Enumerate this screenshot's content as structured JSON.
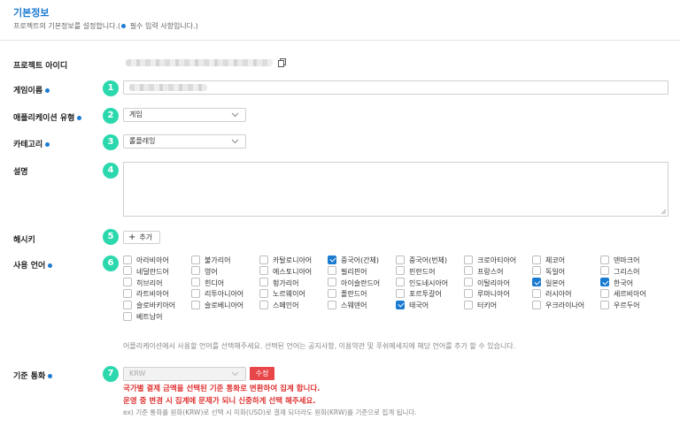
{
  "section": {
    "title": "기본정보",
    "description_prefix": "프로젝트의 기본정보를 설정합니다.(",
    "description_suffix": " 필수 입력 사항입니다.)"
  },
  "fields": {
    "project_id": {
      "label": "프로젝트 아이디"
    },
    "game_name": {
      "label": "게임이름",
      "badge": "1",
      "value": ""
    },
    "app_type": {
      "label": "애플리케이션 유형",
      "badge": "2",
      "value": "게임"
    },
    "category": {
      "label": "카테고리",
      "badge": "3",
      "value": "롤플레잉"
    },
    "description": {
      "label": "설명",
      "badge": "4",
      "value": ""
    },
    "hashtag": {
      "label": "해시키",
      "badge": "5",
      "add_label": "추가",
      "add_icon": "+"
    },
    "languages": {
      "label": "사용 언어",
      "badge": "6",
      "items": [
        {
          "name": "아라비아어",
          "checked": false
        },
        {
          "name": "불가리어",
          "checked": false
        },
        {
          "name": "카탈로니아어",
          "checked": false
        },
        {
          "name": "중국어(간체)",
          "checked": true
        },
        {
          "name": "중국어(번체)",
          "checked": false
        },
        {
          "name": "크로아티아어",
          "checked": false
        },
        {
          "name": "체코어",
          "checked": false
        },
        {
          "name": "덴마크어",
          "checked": false
        },
        {
          "name": "네덜란드어",
          "checked": false
        },
        {
          "name": "영어",
          "checked": false
        },
        {
          "name": "에스토니아어",
          "checked": false
        },
        {
          "name": "필리핀어",
          "checked": false
        },
        {
          "name": "핀란드어",
          "checked": false
        },
        {
          "name": "프랑스어",
          "checked": false
        },
        {
          "name": "독일어",
          "checked": false
        },
        {
          "name": "그리스어",
          "checked": false
        },
        {
          "name": "히브리어",
          "checked": false
        },
        {
          "name": "힌디어",
          "checked": false
        },
        {
          "name": "헝가리어",
          "checked": false
        },
        {
          "name": "아이슬란드어",
          "checked": false
        },
        {
          "name": "인도네시아어",
          "checked": false
        },
        {
          "name": "이탈리아어",
          "checked": false
        },
        {
          "name": "일본어",
          "checked": true
        },
        {
          "name": "한국어",
          "checked": true
        },
        {
          "name": "라트비아어",
          "checked": false
        },
        {
          "name": "리투아니아어",
          "checked": false
        },
        {
          "name": "노르웨이어",
          "checked": false
        },
        {
          "name": "폴란드어",
          "checked": false
        },
        {
          "name": "포르투갈어",
          "checked": false
        },
        {
          "name": "루마니아어",
          "checked": false
        },
        {
          "name": "러시아어",
          "checked": false
        },
        {
          "name": "세르비아어",
          "checked": false
        },
        {
          "name": "슬로바키아어",
          "checked": false
        },
        {
          "name": "슬로베니아어",
          "checked": false
        },
        {
          "name": "스페인어",
          "checked": false
        },
        {
          "name": "스웨덴어",
          "checked": false
        },
        {
          "name": "태국어",
          "checked": true
        },
        {
          "name": "터키어",
          "checked": false
        },
        {
          "name": "우크라이나어",
          "checked": false
        },
        {
          "name": "우르두어",
          "checked": false
        },
        {
          "name": "베트남어",
          "checked": false
        }
      ],
      "help": "어플리케이션에서 사용할 언어를 선택해주세요. 선택된 언어는 공지사항, 이용약관 및 푸쉬메세지에 해당 언어를 추가 할 수 있습니다."
    },
    "currency": {
      "label": "기준 통화",
      "badge": "7",
      "value": "KRW",
      "edit_label": "수정",
      "warning_1": "국가별 결제 금액을 선택된 기준 통화로 변환하여 집계 합니다.",
      "warning_2": "운영 중 변경 시 집계에 문제가 되니 신중하게 선택 해주세요.",
      "example": "ex) 기준 통화를 원화(KRW)로 선택 시 미화(USD)로 결제 되더라도 원화(KRW)를 기준으로 집계 됩니다."
    }
  },
  "colors": {
    "accent": "#1a7bd0",
    "badge": "#2bd8ad",
    "danger": "#e03131",
    "edit_button": "#e8474a"
  }
}
